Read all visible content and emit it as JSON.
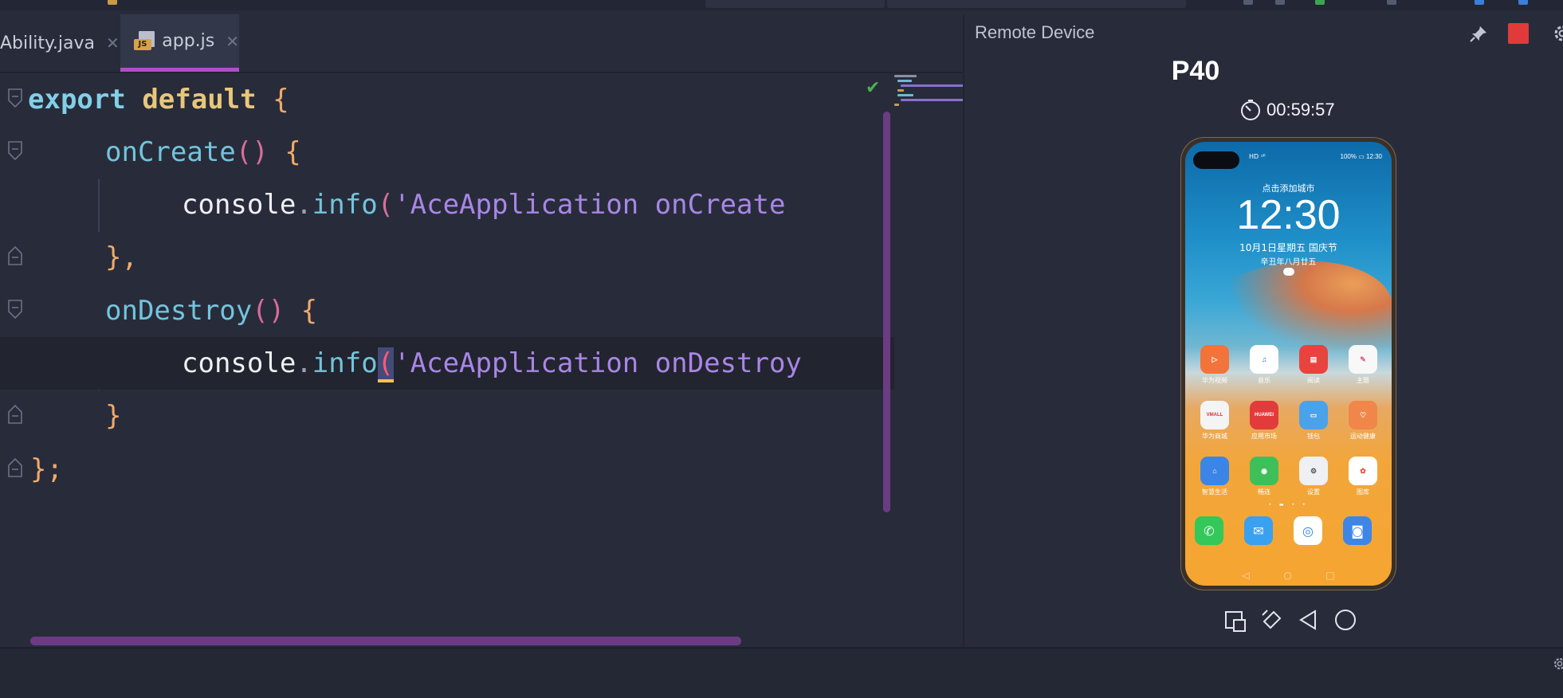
{
  "tabs": [
    {
      "label": "Ability.java",
      "active": false
    },
    {
      "label": "app.js",
      "active": true
    }
  ],
  "code": {
    "line1": {
      "kw1": "export",
      "kw2": "default",
      "brace": "{"
    },
    "line2": {
      "fn": "onCreate",
      "parens": "()",
      "brace": "{"
    },
    "line3": {
      "obj": "console",
      "dot": ".",
      "method": "info",
      "open": "(",
      "str": "'AceApplication onCreate"
    },
    "line4": {
      "close": "},"
    },
    "line5": {
      "fn": "onDestroy",
      "parens": "()",
      "brace": "{"
    },
    "line6": {
      "obj": "console",
      "dot": ".",
      "method": "info",
      "open": "(",
      "str": "'AceApplication onDestroy"
    },
    "line7": {
      "close": "}"
    },
    "line8": {
      "close": "};"
    }
  },
  "remote_device": {
    "panel_title": "Remote Device",
    "device_name": "P40",
    "timer": "00:59:57"
  },
  "phone_screen": {
    "status_left": "HD ᵘˡˡ",
    "status_right": "100% ▭ 12:30",
    "city": "点击添加城市",
    "clock": "12:30",
    "date": "10月1日星期五  国庆节",
    "lunar": "辛丑年八月廿五",
    "apps": [
      {
        "label": "华为视频",
        "icon": "video-icon",
        "color": "#f2743a",
        "glyph": "▷"
      },
      {
        "label": "音乐",
        "icon": "music-icon",
        "color": "#ffffff",
        "glyph": "♫"
      },
      {
        "label": "阅读",
        "icon": "book-icon",
        "color": "#e9433f",
        "glyph": "▤"
      },
      {
        "label": "主题",
        "icon": "theme-icon",
        "color": "#f8f8f8",
        "glyph": "✎"
      },
      {
        "label": "华为商城",
        "icon": "mall-icon",
        "color": "#f4f4f4",
        "glyph": "VMALL"
      },
      {
        "label": "应用市场",
        "icon": "appgallery-icon",
        "color": "#e23b3b",
        "glyph": "HUAWEI"
      },
      {
        "label": "钱包",
        "icon": "wallet-icon",
        "color": "#4aa2ea",
        "glyph": "▭"
      },
      {
        "label": "运动健康",
        "icon": "health-icon",
        "color": "#f0864a",
        "glyph": "♡"
      },
      {
        "label": "智慧生活",
        "icon": "smarthome-icon",
        "color": "#3b85e6",
        "glyph": "⌂"
      },
      {
        "label": "畅连",
        "icon": "meetime-icon",
        "color": "#3fbf5a",
        "glyph": "◉"
      },
      {
        "label": "设置",
        "icon": "settings-icon",
        "color": "#eef0f4",
        "glyph": "⚙"
      },
      {
        "label": "图库",
        "icon": "gallery-icon",
        "color": "#ffffff",
        "glyph": "✿"
      }
    ],
    "dock": [
      {
        "icon": "phone-icon",
        "color": "#34c759",
        "glyph": "✆"
      },
      {
        "icon": "messages-icon",
        "color": "#3aa0f0",
        "glyph": "✉"
      },
      {
        "icon": "browser-icon",
        "color": "#2d7fe6",
        "glyph": "◎"
      },
      {
        "icon": "camera-icon",
        "color": "#3d86e8",
        "glyph": "◙"
      }
    ],
    "nav": [
      "◁",
      "○",
      "□"
    ]
  }
}
